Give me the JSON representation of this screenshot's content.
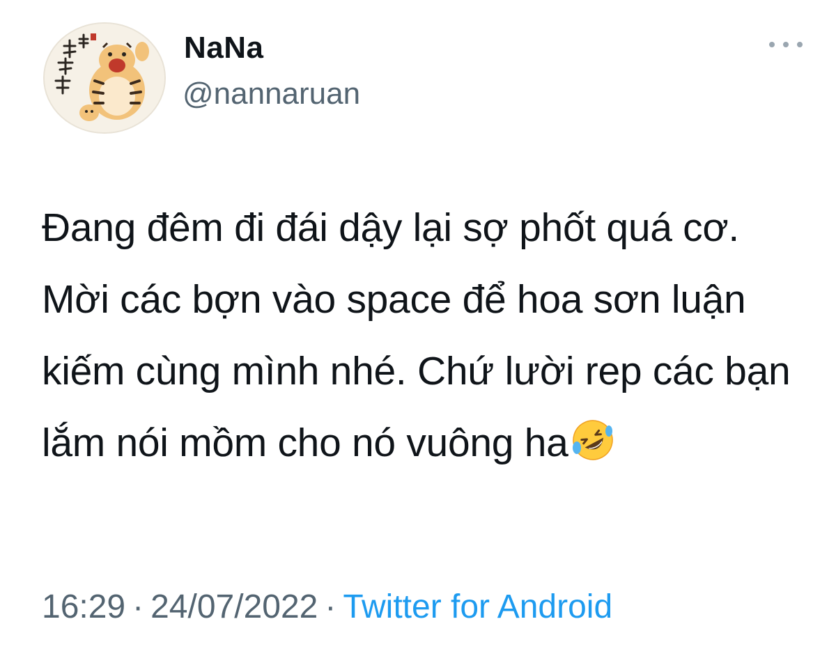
{
  "author": {
    "display_name": "NaNa",
    "handle": "@nannaruan",
    "avatar_icon": "tiger-avatar"
  },
  "tweet": {
    "text": "Đang đêm đi đái dậy lại sợ phốt quá cơ. Mời các bợn vào space để hoa sơn luận kiếm cùng mình nhé. Chứ lười rep các bạn lắm nói mồm cho nó vuông ha",
    "emoji": "rolling-on-the-floor-laughing"
  },
  "meta": {
    "time": "16:29",
    "separator": "·",
    "date": "24/07/2022",
    "source": "Twitter for Android"
  },
  "colors": {
    "text": "#0f1419",
    "secondary": "#536471",
    "link": "#1d9bf0"
  }
}
